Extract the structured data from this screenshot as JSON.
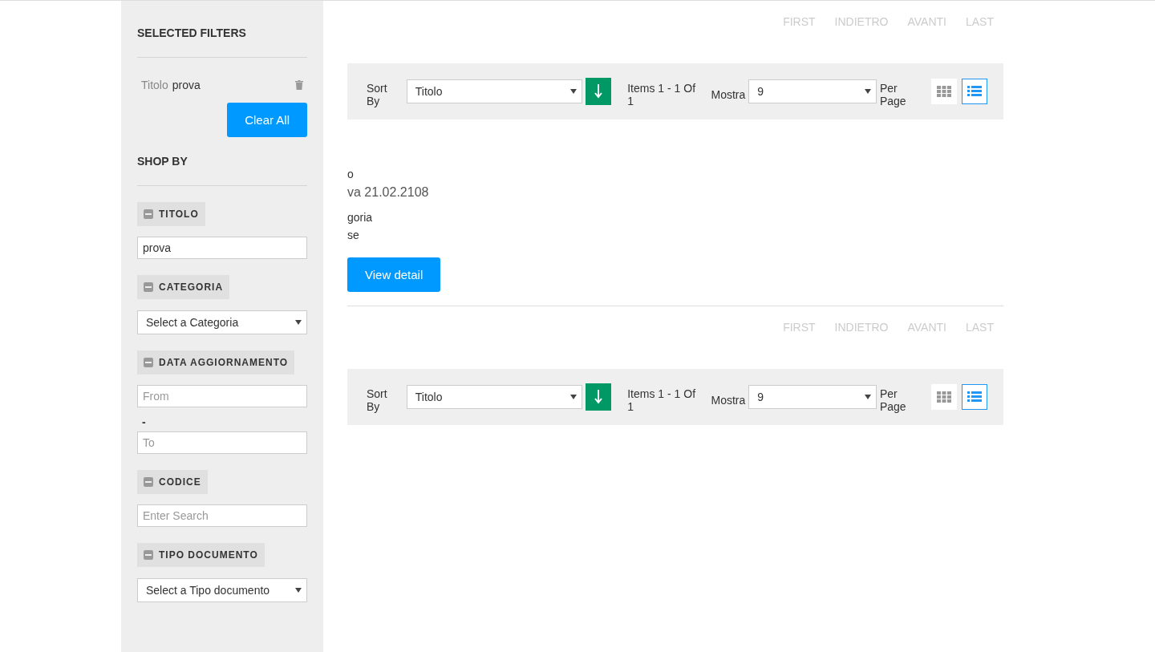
{
  "sidebar": {
    "selected_filters": {
      "title": "SELECTED FILTERS",
      "items": [
        {
          "label": "Titolo",
          "value": "prova"
        }
      ],
      "clear_button": "Clear All"
    },
    "shop_by": {
      "title": "SHOP BY",
      "sections": [
        {
          "title": "TITOLO",
          "expanded": true,
          "kind": "text",
          "value": "prova"
        },
        {
          "title": "CATEGORIA",
          "expanded": true,
          "kind": "select",
          "value": "Select a Categoria"
        },
        {
          "title": "DATA AGGIORNAMENTO",
          "expanded": true,
          "kind": "range",
          "from_placeholder": "From",
          "separator": "-",
          "to_placeholder": "To"
        },
        {
          "title": "CODICE",
          "expanded": true,
          "kind": "text",
          "placeholder": "Enter Search"
        },
        {
          "title": "TIPO DOCUMENTO",
          "expanded": true,
          "kind": "select",
          "value": "Select a Tipo documento"
        }
      ]
    }
  },
  "main": {
    "blocks": [
      {
        "kind": "toolbar",
        "pager": [
          {
            "label": "FIRST",
            "disabled": true
          },
          {
            "label": "INDIETRO",
            "disabled": true
          },
          {
            "label": "AVANTI",
            "disabled": true
          },
          {
            "label": "LAST",
            "disabled": true
          }
        ],
        "sort_label": "Sort By",
        "sort_value": "Titolo",
        "items_text": "Items 1 - 1 Of 1",
        "show_label": "Mostra",
        "per_page_value": "9",
        "per_page_label": "Per Page",
        "views": [
          {
            "kind": "grid",
            "selected": false
          },
          {
            "kind": "list",
            "selected": true
          }
        ]
      },
      {
        "kind": "result",
        "lines": [
          "o",
          "va 21.02.2108",
          "goria",
          "se"
        ],
        "button": "View detail"
      },
      {
        "kind": "toolbar",
        "pager": [
          {
            "label": "FIRST",
            "disabled": true
          },
          {
            "label": "INDIETRO",
            "disabled": true
          },
          {
            "label": "AVANTI",
            "disabled": true
          },
          {
            "label": "LAST",
            "disabled": true
          }
        ],
        "sort_label": "Sort By",
        "sort_value": "Titolo",
        "items_text": "Items 1 - 1 Of 1",
        "show_label": "Mostra",
        "per_page_value": "9",
        "per_page_label": "Per Page",
        "views": [
          {
            "kind": "grid",
            "selected": false
          },
          {
            "kind": "list",
            "selected": true
          }
        ]
      }
    ]
  }
}
